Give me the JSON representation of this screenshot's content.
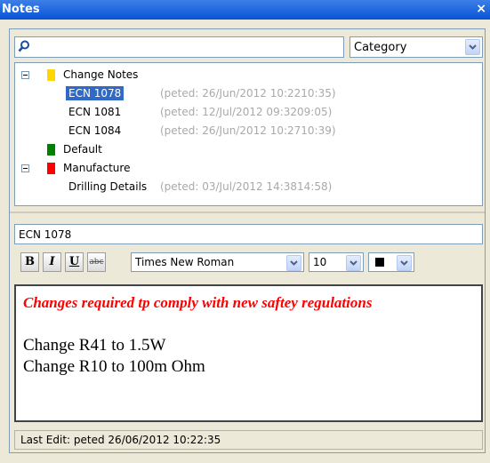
{
  "window": {
    "title": "Notes",
    "close_glyph": "×"
  },
  "search": {
    "value": "",
    "icon": "search-icon"
  },
  "category_select": {
    "value": "Category"
  },
  "tree": {
    "groups": [
      {
        "label": "Change Notes",
        "color": "#ffd700",
        "expanded": true,
        "items": [
          {
            "label": "ECN 1078",
            "meta": "(peted: 26/Jun/2012 10:2210:35)",
            "selected": true
          },
          {
            "label": "ECN 1081",
            "meta": "(peted: 12/Jul/2012 09:3209:05)",
            "selected": false
          },
          {
            "label": "ECN 1084",
            "meta": "(peted: 26/Jun/2012 10:2710:39)",
            "selected": false
          }
        ]
      },
      {
        "label": "Default",
        "color": "#008000",
        "expanded": false,
        "items": []
      },
      {
        "label": "Manufacture",
        "color": "#ff0000",
        "expanded": true,
        "items": [
          {
            "label": "Drilling Details",
            "meta": "(peted: 03/Jul/2012 14:3814:58)",
            "selected": false
          }
        ]
      }
    ]
  },
  "note": {
    "title": "ECN 1078",
    "toolbar": {
      "bold_label": "B",
      "italic_label": "I",
      "underline_label": "U",
      "strike_label": "abc",
      "font_family": "Times New Roman",
      "font_size": "10",
      "font_color": "#000000"
    },
    "body": {
      "heading": "Changes required tp comply with new saftey regulations",
      "heading_color": "#ff0000",
      "lines": [
        "Change R41 to 1.5W",
        "Change R10 to 100m Ohm"
      ]
    },
    "status": "Last Edit: peted  26/06/2012 10:22:35"
  }
}
